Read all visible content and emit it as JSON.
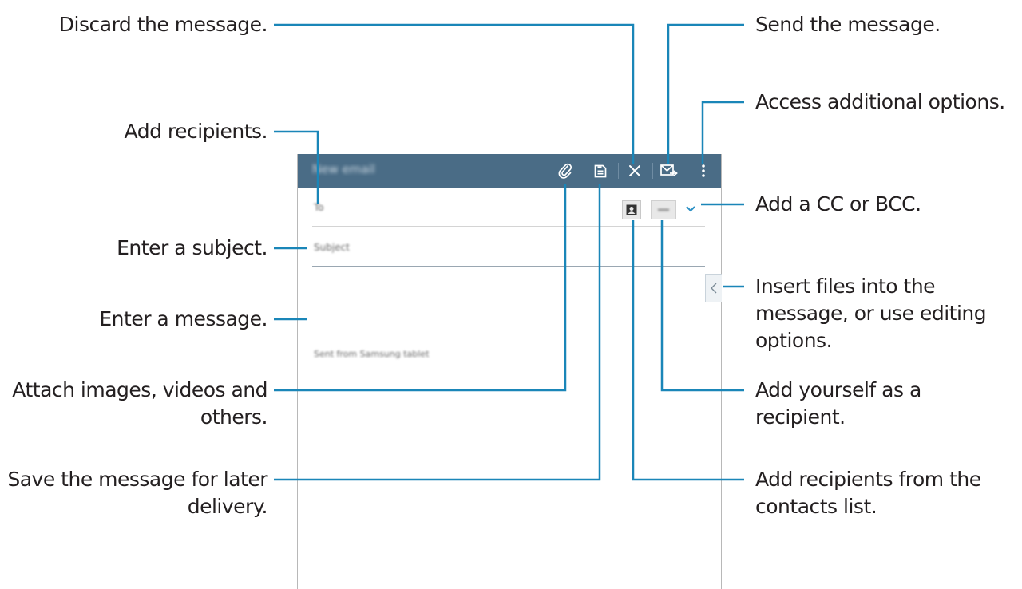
{
  "app": {
    "title": "New email",
    "to_label": "To",
    "subject_label": "Subject",
    "signature": "Sent from Samsung tablet"
  },
  "toolbar": {
    "icons": [
      "attach-icon",
      "save-icon",
      "discard-icon",
      "send-icon",
      "overflow-menu-icon"
    ]
  },
  "callouts": {
    "discard": "Discard the message.",
    "add_recipients": "Add recipients.",
    "enter_subject": "Enter a subject.",
    "enter_message": "Enter a message.",
    "attach_line1": "Attach images, videos and",
    "attach_line2": "others.",
    "save_line1": "Save the message for later",
    "save_line2": "delivery.",
    "send": "Send the message.",
    "options": "Access additional options.",
    "ccbcc": "Add a CC or BCC.",
    "insert_line1": "Insert files into the",
    "insert_line2": "message, or use editing",
    "insert_line3": "options.",
    "yourself_line1": "Add yourself as a",
    "yourself_line2": "recipient.",
    "contacts_line1": "Add recipients from the",
    "contacts_line2": "contacts list."
  },
  "colors": {
    "callout_line": "#1a86b8",
    "action_bar": "#4a6c86",
    "text": "#231f20"
  }
}
